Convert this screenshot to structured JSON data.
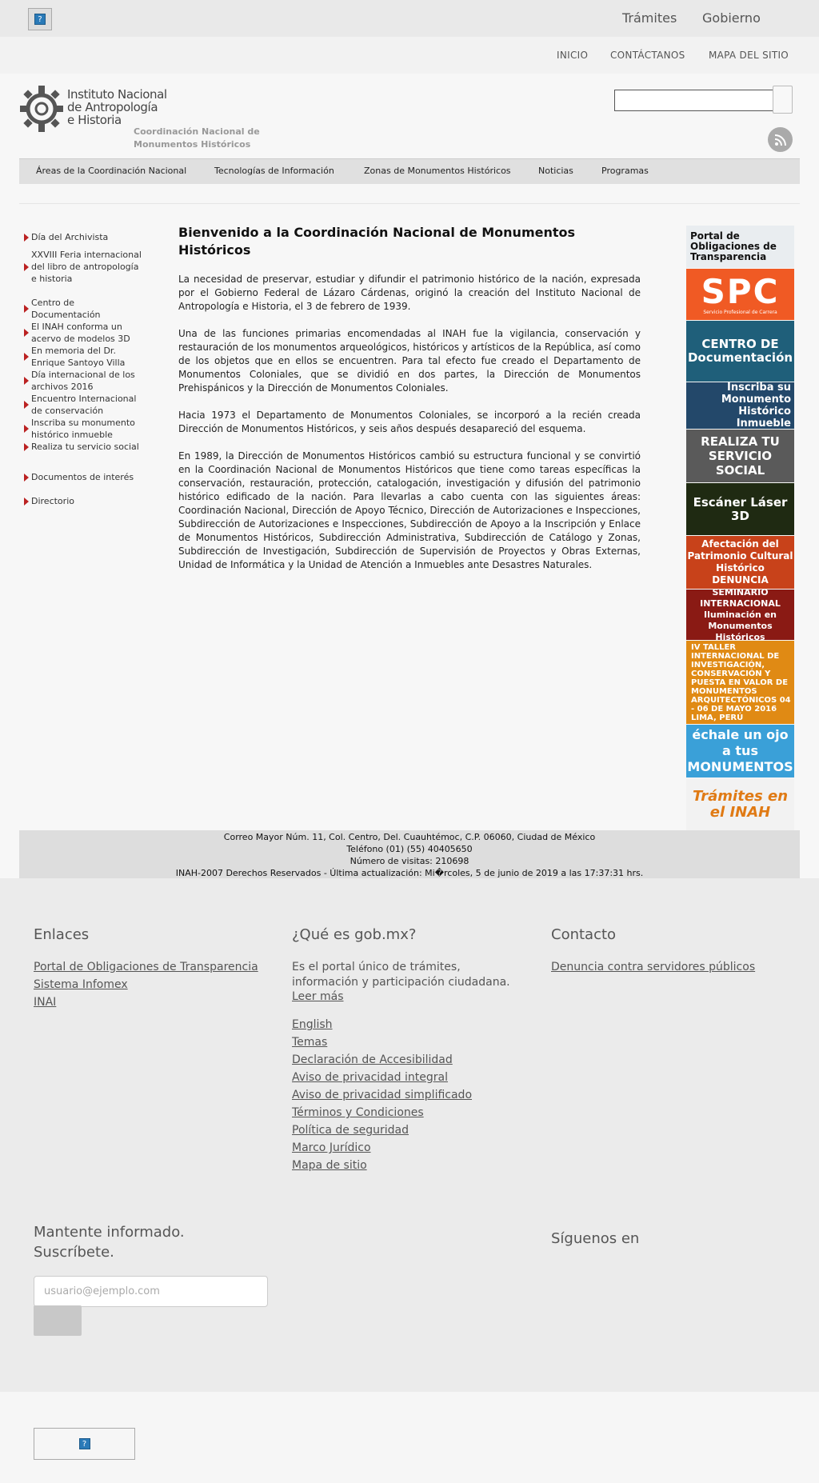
{
  "gob_header": {
    "links": [
      "Trámites",
      "Gobierno"
    ],
    "logo_icon": "broken-image-icon"
  },
  "secondary_nav": [
    "INICIO",
    "CONTÁCTANOS",
    "MAPA DEL SITIO"
  ],
  "header": {
    "logo_lines": [
      "Instituto Nacional",
      "de Antropología",
      "e Historia"
    ],
    "subtitle_lines": [
      "Coordinación Nacional de",
      "Monumentos Históricos"
    ],
    "search_value": "",
    "rss_icon": "rss-icon"
  },
  "main_menu": [
    "Áreas de la Coordinación Nacional",
    "Tecnologías de Información",
    "Zonas de Monumentos Históricos",
    "Noticias",
    "Programas"
  ],
  "sidebar": [
    "Día del Archivista",
    "XXVIII Feria internacional del libro de antropología e historia",
    "Centro de Documentación",
    "El INAH conforma un acervo de modelos 3D",
    "En memoria del Dr. Enrique Santoyo Villa",
    "Día internacional de los archivos 2016",
    "Encuentro Internacional de conservación",
    "Inscriba su monumento histórico inmueble",
    "Realiza tu servicio social",
    "Documentos de interés",
    "Directorio"
  ],
  "article": {
    "title": "Bienvenido a la Coordinación Nacional de Monumentos Históricos",
    "paragraphs": [
      "La necesidad de preservar, estudiar y difundir el patrimonio histórico de la nación, expresada por el Gobierno Federal de Lázaro Cárdenas, originó la creación del Instituto Nacional de Antropología e Historia, el 3 de febrero de 1939.",
      "Una de las funciones primarias encomendadas al INAH fue la vigilancia, conservación y restauración de los monumentos arqueológicos, históricos y artísticos de la República, así como de los objetos que en ellos se encuentren. Para tal efecto fue creado el Departamento de Monumentos Coloniales, que se dividió en dos partes, la Dirección de Monumentos Prehispánicos y la Dirección de Monumentos Coloniales.",
      "Hacia 1973 el Departamento de Monumentos Coloniales, se incorporó a la recién creada Dirección de Monumentos Históricos, y seis años después desapareció del esquema.",
      "En 1989, la Dirección de Monumentos Históricos cambió su estructura funcional y se convirtió en la Coordinación Nacional de Monumentos Históricos que tiene como tareas específicas la conservación, restauración, protección, catalogación, investigación y difusión del patrimonio histórico edificado de la nación. Para llevarlas a cabo cuenta con las siguientes áreas: Coordinación Nacional, Dirección de Apoyo Técnico, Dirección de Autorizaciones e Inspecciones, Subdirección de Autorizaciones e Inspecciones, Subdirección de Apoyo a la Inscripción y Enlace de Monumentos Históricos, Subdirección Administrativa, Subdirección de Catálogo y Zonas, Subdirección de Investigación, Subdirección de Supervisión de Proyectos y Obras Externas, Unidad de Informática y la Unidad de Atención a Inmuebles ante Desastres Naturales."
    ]
  },
  "banners": [
    {
      "text": "Portal de Obligaciones de Transparencia",
      "bg": "#e9edf0",
      "color": "#111"
    },
    {
      "text": "SPC",
      "sub": "Servicio Profesional de Carrera",
      "bg": "#f05a24",
      "color": "#ffffff"
    },
    {
      "text": "CENTRO DE Documentación",
      "bg": "#1f5f7a",
      "color": "#ffffff"
    },
    {
      "text": "Inscriba su Monumento Histórico Inmueble",
      "bg": "#23486a",
      "color": "#ffffff"
    },
    {
      "text": "REALIZA TU SERVICIO SOCIAL",
      "bg": "#5a5a5a",
      "color": "#ffffff"
    },
    {
      "text": "Escáner Láser 3D",
      "bg": "#1f2a12",
      "color": "#ffffff"
    },
    {
      "text": "Afectación del Patrimonio Cultural Histórico DENUNCIA",
      "bg": "#c8421a",
      "color": "#ffffff"
    },
    {
      "text": "SEMINARIO INTERNACIONAL Iluminación en Monumentos Históricos",
      "bg": "#8a1a14",
      "color": "#ffffff"
    },
    {
      "text": "IV TALLER INTERNACIONAL DE INVESTIGACIÓN, CONSERVACIÓN Y PUESTA EN VALOR DE MONUMENTOS ARQUITECTÓNICOS 04 - 06 DE MAYO 2016 LIMA, PERÚ",
      "bg": "#e08a14",
      "color": "#ffffff"
    },
    {
      "text": "échale un ojo a tus MONUMENTOS",
      "bg": "#3aa0d8",
      "color": "#ffffff"
    },
    {
      "text": "Trámites en el INAH",
      "bg": "#f2f2f2",
      "color": "#e07a14"
    }
  ],
  "site_footer": [
    "Correo Mayor Núm. 11, Col. Centro, Del. Cuauhtémoc, C.P. 06060, Ciudad de México",
    "Teléfono (01) (55) 40405650",
    "Número de visitas: 210698",
    "INAH-2007 Derechos Reservados -  Última actualización: Mi�rcoles, 5 de junio de 2019 a las 17:37:31 hrs."
  ],
  "gob_footer": {
    "enlaces": {
      "title": "Enlaces",
      "links": [
        "Portal de Obligaciones de Transparencia",
        "Sistema Infomex",
        "INAI"
      ]
    },
    "que_es": {
      "title": "¿Qué es gob.mx?",
      "text": "Es el portal único de trámites, información y participación ciudadana.",
      "leer_mas": "Leer más",
      "links": [
        "English",
        "Temas",
        "Declaración de Accesibilidad",
        "Aviso de privacidad integral",
        "Aviso de privacidad simplificado",
        "Términos y Condiciones",
        "Política de seguridad",
        "Marco Jurídico",
        "Mapa de sitio"
      ]
    },
    "contacto": {
      "title": "Contacto",
      "link": "Denuncia contra servidores públicos"
    },
    "newsletter": {
      "title_lines": [
        "Mantente informado.",
        "Suscríbete."
      ],
      "placeholder": "usuario@ejemplo.com"
    },
    "siguenos": "Síguenos en"
  }
}
